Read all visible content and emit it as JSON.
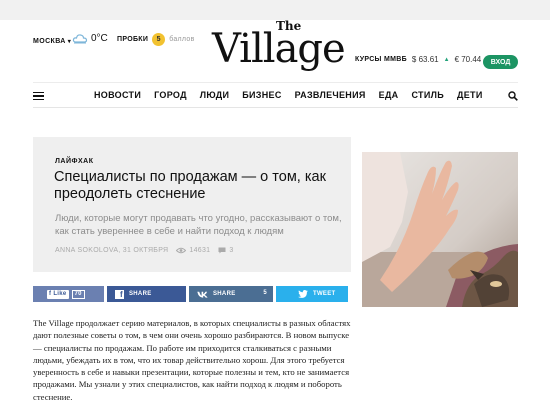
{
  "header": {
    "city": "МОСКВА",
    "weather": "0°C",
    "traffic_label": "ПРОБКИ",
    "traffic_value": "5",
    "traffic_unit": "баллов",
    "logo_the": "The",
    "logo_main": "Village",
    "rates_label": "КУРСЫ ММВБ",
    "usd": "$ 63.61",
    "eur": "€ 70.44",
    "login": "ВХОД"
  },
  "nav": {
    "items": [
      "НОВОСТИ",
      "ГОРОД",
      "ЛЮДИ",
      "БИЗНЕС",
      "РАЗВЛЕЧЕНИЯ",
      "ЕДА",
      "СТИЛЬ",
      "ДЕТИ"
    ]
  },
  "article": {
    "rubric": "ЛАЙФХАК",
    "title": "Специалисты по продажам — о том, как преодолеть стеснение",
    "lead": "Люди, которые могут продавать что угодно, рассказывают о том, как стать увереннее в себе и найти подход к людям",
    "author_date": "ANNA SOKOLOVA, 31 ОКТЯБРЯ",
    "views": "14631",
    "comments": "3"
  },
  "share": {
    "like": "Like",
    "like_count": "70",
    "fb": "SHARE",
    "vk": "SHARE",
    "vk_count": "5",
    "tw": "TWEET"
  },
  "body": {
    "paragraph": "The Village продолжает серию материалов, в которых специалисты в разных областях дают полезные советы о том, в чем они очень хорошо разбираются. В новом выпуске — специалисты по продажам. По работе им приходится сталкиваться с разными людьми, убеждать их в том, что их товар действительно хорош. Для этого требуется уверенность в себе и навыки презентации, которые полезны и тем, кто не занимается продажами. Мы узнали у этих специалистов, как найти подход к людям и побороть стеснение."
  },
  "colors": {
    "login_green": "#1c9463",
    "facebook": "#3b5996",
    "vk": "#4b6e93",
    "twitter": "#2ab0ec",
    "article_bg": "#efefef"
  },
  "icons": [
    "weather-cloud-icon",
    "traffic-badge-icon",
    "menu-icon",
    "search-icon",
    "views-eye-icon",
    "comments-icon",
    "facebook-icon",
    "vk-icon",
    "twitter-icon"
  ]
}
